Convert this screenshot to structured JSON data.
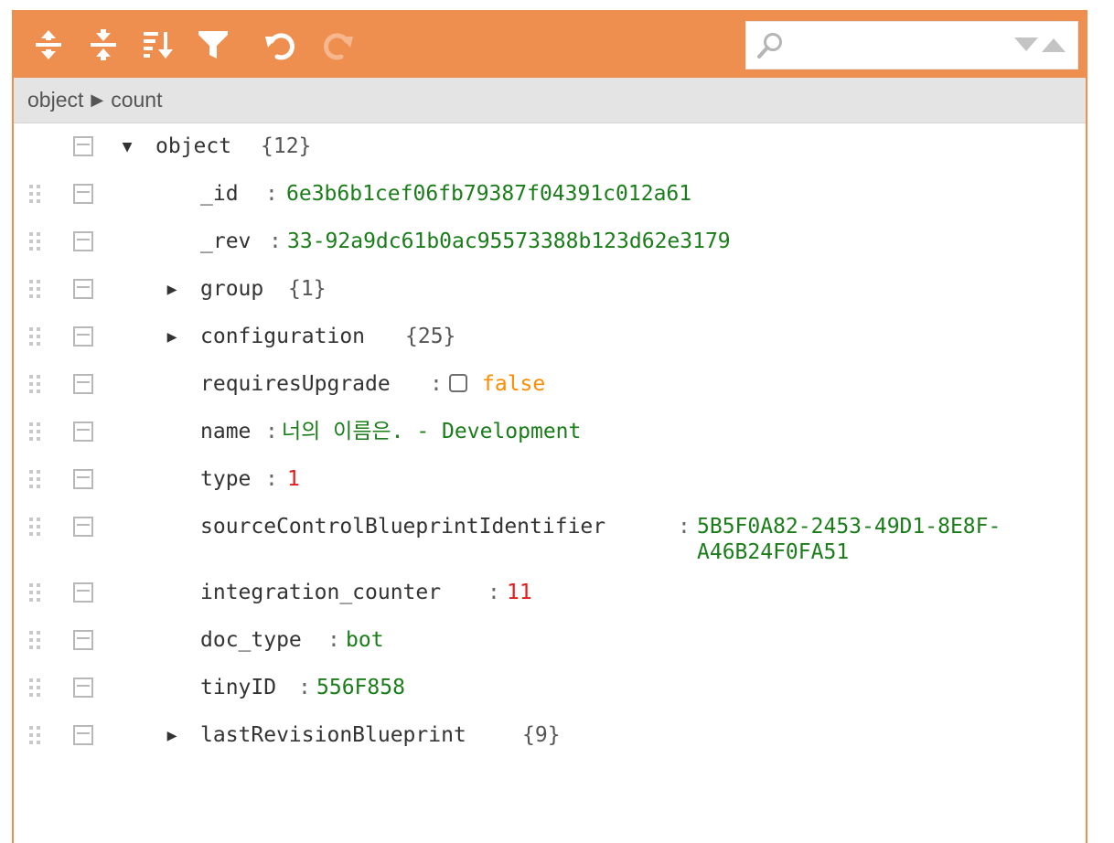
{
  "toolbar": {
    "icons": [
      "expand-all-icon",
      "collapse-all-icon",
      "sort-icon",
      "filter-icon",
      "undo-icon",
      "redo-icon"
    ],
    "search_value": "",
    "accent_color": "#ef8f4f"
  },
  "breadcrumb": {
    "items": [
      "object",
      "count"
    ]
  },
  "tree": {
    "root": {
      "field": "object",
      "meta": "{12}"
    },
    "rows": [
      {
        "field": "_id",
        "sep": ":",
        "value": "6e3b6b1cef06fb79387f04391c012a61"
      },
      {
        "field": "_rev",
        "sep": ":",
        "value": "33-92a9dc61b0ac95573388b123d62e3179"
      },
      {
        "field": "group",
        "meta": "{1}"
      },
      {
        "field": "configuration",
        "meta": "{25}"
      },
      {
        "field": "requiresUpgrade",
        "sep": ":",
        "value": "false"
      },
      {
        "field": "name",
        "sep": ":",
        "value": "너의 이름은. - Development"
      },
      {
        "field": "type",
        "sep": ":",
        "value": "1"
      },
      {
        "field": "sourceControlBlueprintIdentifier",
        "sep": ":",
        "value_line1": "5B5F0A82-2453-49D1-8E8F-",
        "value_line2": "A46B24F0FA51"
      },
      {
        "field": "integration_counter",
        "sep": ":",
        "value": "11"
      },
      {
        "field": "doc_type",
        "sep": ":",
        "value": "bot"
      },
      {
        "field": "tinyID",
        "sep": ":",
        "value": "556F858"
      },
      {
        "field": "lastRevisionBlueprint",
        "meta": "{9}"
      }
    ]
  },
  "colors": {
    "string_value": "#1a7d1a",
    "number_value": "#e01e1e",
    "boolean_value": "#ff8c00"
  }
}
